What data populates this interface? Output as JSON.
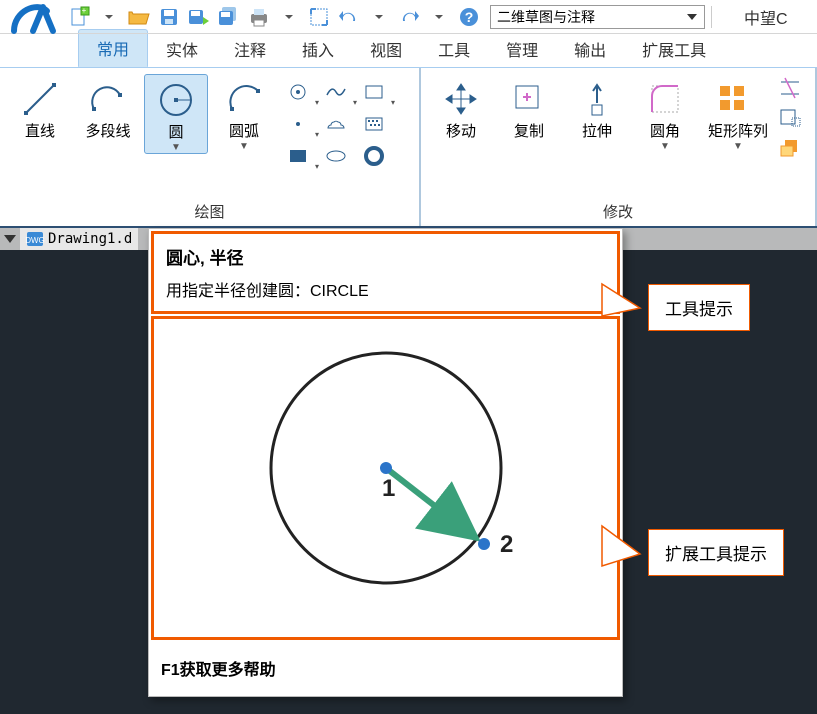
{
  "qat": {
    "workspace": "二维草图与注释",
    "brand": "中望C"
  },
  "tabs": [
    "常用",
    "实体",
    "注释",
    "插入",
    "视图",
    "工具",
    "管理",
    "输出",
    "扩展工具"
  ],
  "activeTab": 0,
  "panels": {
    "draw": {
      "title": "绘图",
      "big": {
        "line": "直线",
        "pline": "多段线",
        "circle": "圆",
        "arc": "圆弧"
      }
    },
    "modify": {
      "title": "修改",
      "big": {
        "move": "移动",
        "copy": "复制",
        "stretch": "拉伸",
        "fillet": "圆角",
        "rectarray": "矩形阵列"
      }
    }
  },
  "docTab": "Drawing1.d",
  "tooltip": {
    "title": "圆心, 半径",
    "desc": "用指定半径创建圆：CIRCLE",
    "label1": "1",
    "label2": "2",
    "foot": "F1获取更多帮助"
  },
  "callouts": {
    "tooltip_label": "工具提示",
    "ext_label": "扩展工具提示"
  }
}
